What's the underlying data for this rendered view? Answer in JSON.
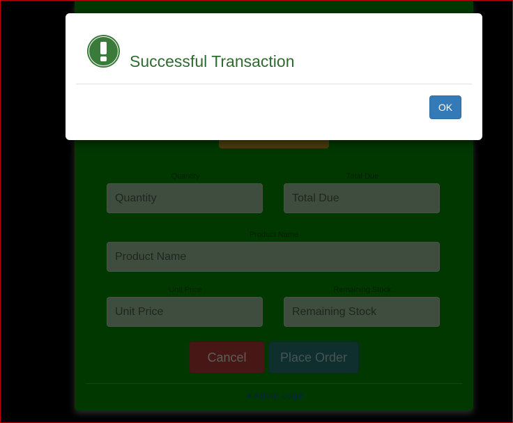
{
  "form": {
    "quantity_label": "Quantity",
    "quantity_placeholder": "Quantity",
    "total_due_label": "Total Due",
    "total_due_placeholder": "Total Due",
    "product_name_label": "Product Name",
    "product_name_placeholder": "Product Name",
    "unit_price_label": "Unit Price",
    "unit_price_placeholder": "Unit Price",
    "remaining_stock_label": "Remaining Stock",
    "remaining_stock_placeholder": "Remaining Stock",
    "cancel_label": "Cancel",
    "place_order_label": "Place Order",
    "admin_login_label": "Admin Login"
  },
  "modal": {
    "title": "Successful Transaction",
    "ok_label": "OK",
    "icon": "exclamation-circle-icon"
  },
  "colors": {
    "panel_green": "#007000",
    "modal_title": "#2e6b2e",
    "ok_button": "#337ab7",
    "cancel_button": "#d9534f",
    "place_order_button": "#2a8c86"
  }
}
